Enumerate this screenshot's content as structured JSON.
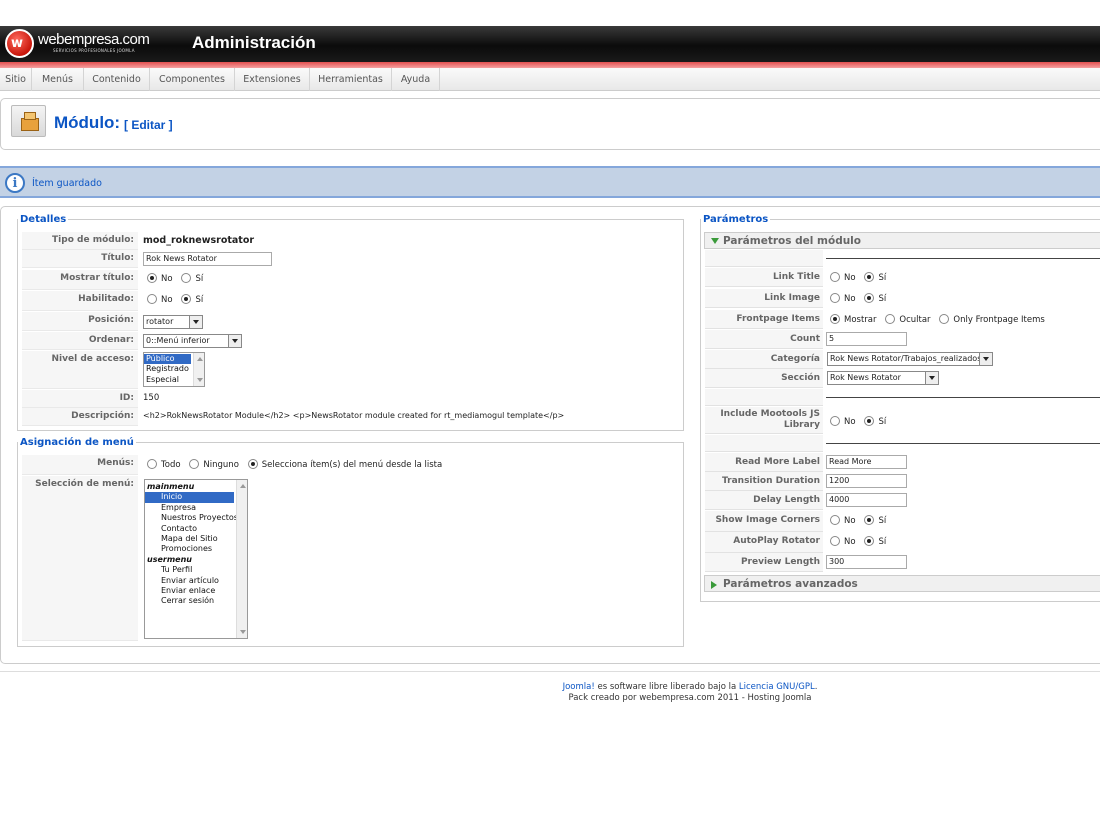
{
  "header": {
    "logo_mark": "w",
    "logo_text": "webempresa.com",
    "logo_subtext": "SERVICIOS PROFESIONALES JOOMLA",
    "title": "Administración"
  },
  "menu": [
    "Sitio",
    "Menús",
    "Contenido",
    "Componentes",
    "Extensiones",
    "Herramientas",
    "Ayuda"
  ],
  "toolbar": {
    "title": "Módulo:",
    "subtitle": "[ Editar ]"
  },
  "message": {
    "text": "Ítem guardado"
  },
  "details": {
    "legend": "Detalles",
    "tipo_label": "Tipo de módulo:",
    "tipo_value": "mod_roknewsrotator",
    "titulo_label": "Título:",
    "titulo_value": "Rok News Rotator",
    "mostrar_label": "Mostrar título:",
    "habilitado_label": "Habilitado:",
    "no": "No",
    "si": "Sí",
    "posicion_label": "Posición:",
    "posicion_value": "rotator",
    "ordenar_label": "Ordenar:",
    "ordenar_value": "0::Menú inferior",
    "nivel_label": "Nivel de acceso:",
    "nivel_options": [
      "Público",
      "Registrado",
      "Especial"
    ],
    "id_label": "ID:",
    "id_value": "150",
    "desc_label": "Descripción:",
    "desc_value": "<h2>RokNewsRotator Module</h2> <p>NewsRotator module created for rt_mediamogul template</p>"
  },
  "menu_assignment": {
    "legend": "Asignación de menú",
    "menus_label": "Menús:",
    "opt_todo": "Todo",
    "opt_ninguno": "Ninguno",
    "opt_selecciona": "Selecciona ítem(s) del menú desde la lista",
    "seleccion_label": "Selección de menú:",
    "items": [
      "mainmenu",
      "Inicio",
      "Empresa",
      "Nuestros Proyectos",
      "Contacto",
      "Mapa del Sitio",
      "Promociones",
      "usermenu",
      "Tu Perfil",
      "Enviar artículo",
      "Enviar enlace",
      "Cerrar sesión"
    ]
  },
  "params": {
    "legend": "Parámetros",
    "module_header": "Parámetros del módulo",
    "advanced_header": "Parámetros avanzados",
    "no": "No",
    "si": "Sí",
    "link_title_label": "Link Title",
    "link_image_label": "Link Image",
    "frontpage_label": "Frontpage Items",
    "opt_mostrar": "Mostrar",
    "opt_ocultar": "Ocultar",
    "opt_only": "Only Frontpage Items",
    "count_label": "Count",
    "count_value": "5",
    "categoria_label": "Categoría",
    "categoria_value": "Rok News Rotator/Trabajos_realizados",
    "seccion_label": "Sección",
    "seccion_value": "Rok News Rotator",
    "mootools_label": "Include Mootools JS Library",
    "readmore_label": "Read More Label",
    "readmore_value": "Read More",
    "transition_label": "Transition Duration",
    "transition_value": "1200",
    "delay_label": "Delay Length",
    "delay_value": "4000",
    "corners_label": "Show Image Corners",
    "autoplay_label": "AutoPlay Rotator",
    "preview_label": "Preview Length",
    "preview_value": "300"
  },
  "footer": {
    "joomla": "Joomla!",
    "line1_mid": " es software libre liberado bajo la ",
    "license": "Licencia GNU/GPL",
    "line1_end": ".",
    "line2": "Pack creado por webempresa.com 2011 - Hosting Joomla"
  }
}
